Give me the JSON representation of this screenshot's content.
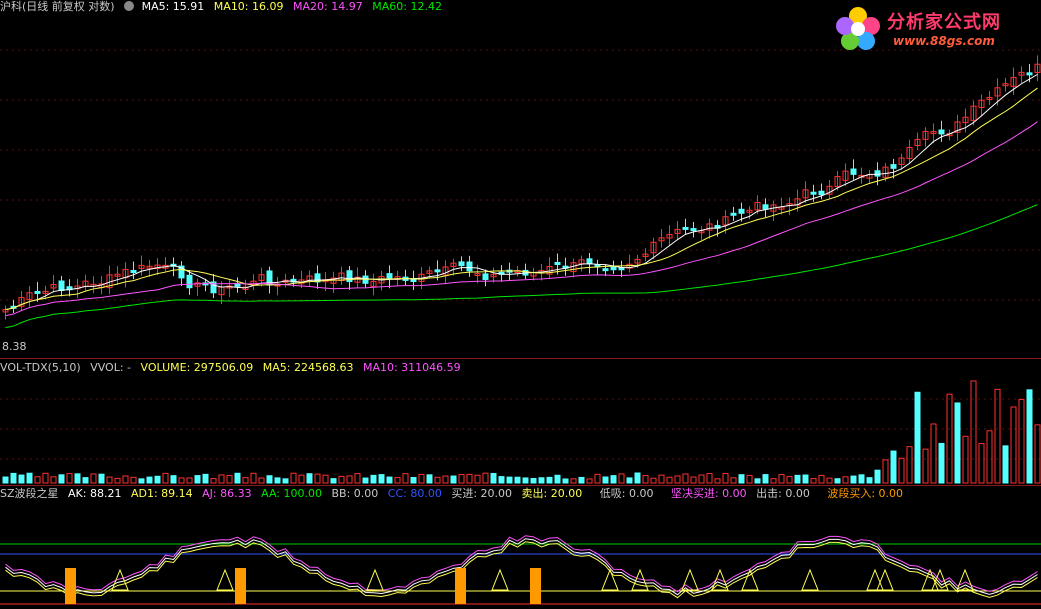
{
  "main_panel": {
    "title": "沪科(日线 前复权 对数)",
    "ma5": "MA5: 15.91",
    "ma10": "MA10: 16.09",
    "ma20": "MA20: 14.97",
    "ma60": "MA60: 12.42",
    "low_label": "8.38"
  },
  "watermark": {
    "name": "分析家公式网",
    "url": "www.88gs.com"
  },
  "vol_panel": {
    "title": "VOL-TDX(5,10)",
    "vvol": "VVOL: -",
    "volume": "VOLUME: 297506.09",
    "ma5": "MA5: 224568.63",
    "ma10": "MA10: 311046.59"
  },
  "ind_panel": {
    "title": "SZ波段之星",
    "ak": "AK: 88.21",
    "ad1": "AD1: 89.14",
    "aj": "AJ: 86.33",
    "aa": "AA: 100.00",
    "bb": "BB: 0.00",
    "cc": "CC: 80.00",
    "buy_in": "买进: 20.00",
    "sell_out": "卖出: 20.00",
    "low_suck": "低吸: 0.00",
    "firm_buy": "坚决买进: 0.00",
    "strike": "出击: 0.00",
    "wave_buy": "波段买入: 0.00"
  },
  "colors": {
    "up": "#ff3030",
    "down": "#54ffff",
    "ma5": "#ffffff",
    "ma10": "#ffff54",
    "ma20": "#ff54ff",
    "ma60": "#00e600",
    "separator": "#8b1a1a",
    "orange_bar": "#ff9900"
  }
}
